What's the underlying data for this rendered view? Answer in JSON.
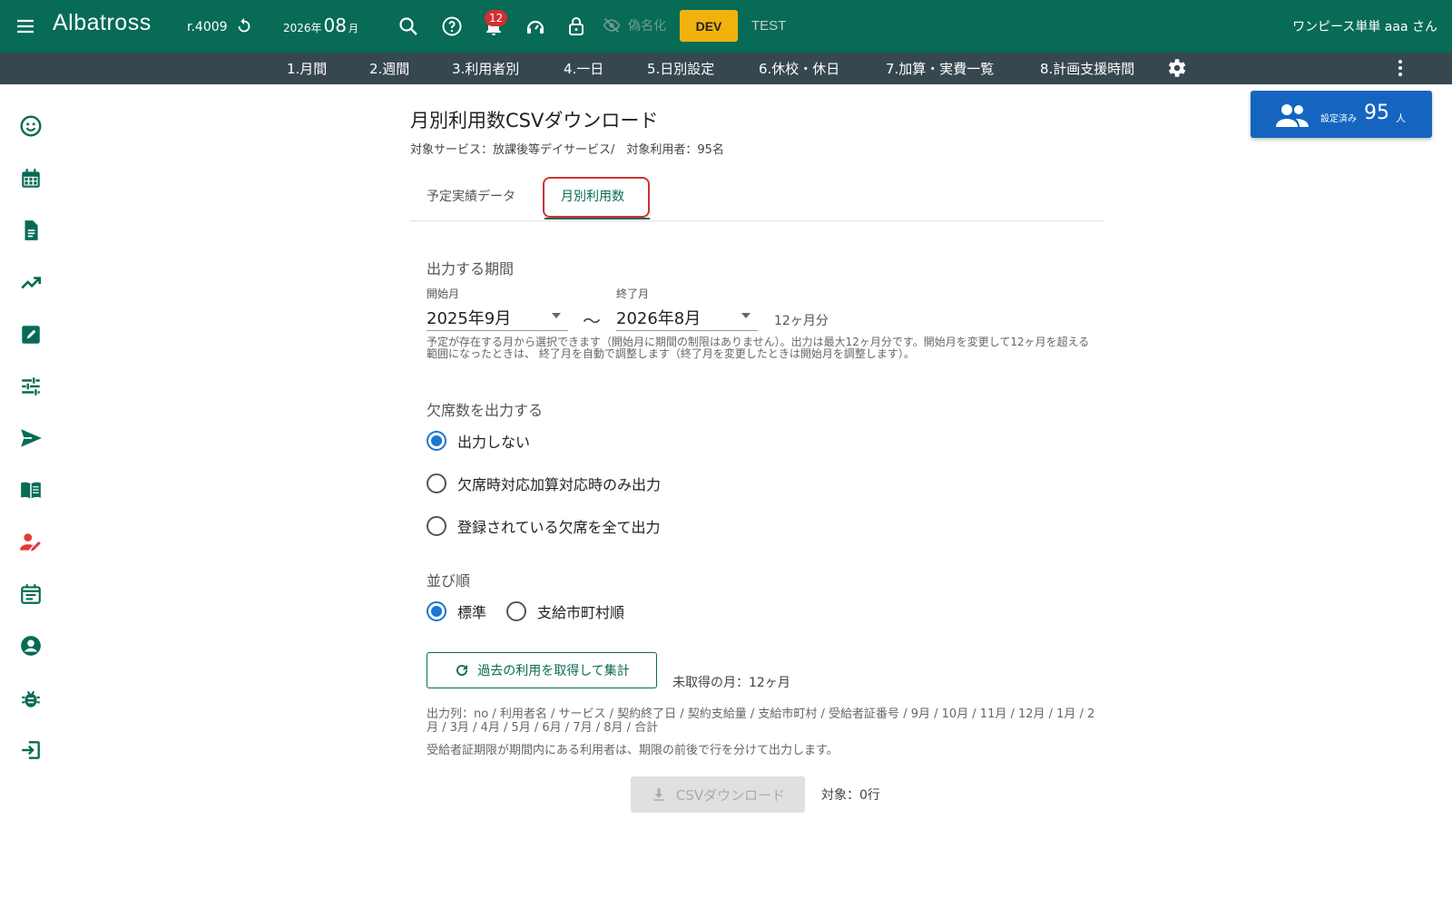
{
  "header": {
    "logo": "Albatross",
    "version": "r.4009",
    "month": {
      "year": "2026年",
      "month": "08",
      "unit": "月"
    },
    "notification_count": "12",
    "pseudonym_label": "偽名化",
    "dev_label": "DEV",
    "test_label": "TEST",
    "user_name": "ワンピース単単 aaa さん"
  },
  "nav": {
    "items": [
      "1.月間",
      "2.週間",
      "3.利用者別",
      "4.一日",
      "5.日別設定",
      "6.休校・休日",
      "7.加算・実費一覧",
      "8.計画支援時間"
    ]
  },
  "users_summary": {
    "label": "設定済み",
    "count": "95",
    "unit": "人"
  },
  "page": {
    "title": "月別利用数CSVダウンロード",
    "subtitle": "対象サービス：放課後等デイサービス/　対象利用者：95名",
    "tabs": [
      "予定実績データ",
      "月別利用数"
    ],
    "period": {
      "label": "出力する期間",
      "start_label": "開始月",
      "start_value": "2025年9月",
      "tilde": "〜",
      "end_label": "終了月",
      "end_value": "2026年8月",
      "range": "12ヶ月分",
      "help": "予定が存在する月から選択できます（開始月に期間の制限はありません）。出力は最大12ヶ月分です。開始月を変更して12ヶ月を超える範囲になったときは、 終了月を自動で調整します（終了月を変更したときは開始月を調整します）。"
    },
    "absence": {
      "label": "欠席数を出力する",
      "options": [
        "出力しない",
        "欠席時対応加算対応時のみ出力",
        "登録されている欠席を全て出力"
      ]
    },
    "sort": {
      "label": "並び順",
      "options": [
        "標準",
        "支給市町村順"
      ]
    },
    "refresh_button": "過去の利用を取得して集計",
    "pending_months": "未取得の月：12ヶ月",
    "columns_note": "出力列：no / 利用者名 / サービス / 契約終了日 / 契約支給量 / 支給市町村 / 受給者証番号 / 9月 / 10月 / 11月 / 12月 / 1月 / 2月 / 3月 / 4月 / 5月 / 6月 / 7月 / 8月 / 合計",
    "split_note": "受給者証期限が期間内にある利用者は、期限の前後で行を分けて出力します。",
    "download_button": "CSVダウンロード",
    "target_rows": "対象：0行"
  },
  "colors": {
    "primary": "#076b55",
    "nav_bg": "#37474f",
    "accent_blue": "#1565c0",
    "dev_yellow": "#f2b20d",
    "highlight_red": "#d32f2f"
  }
}
